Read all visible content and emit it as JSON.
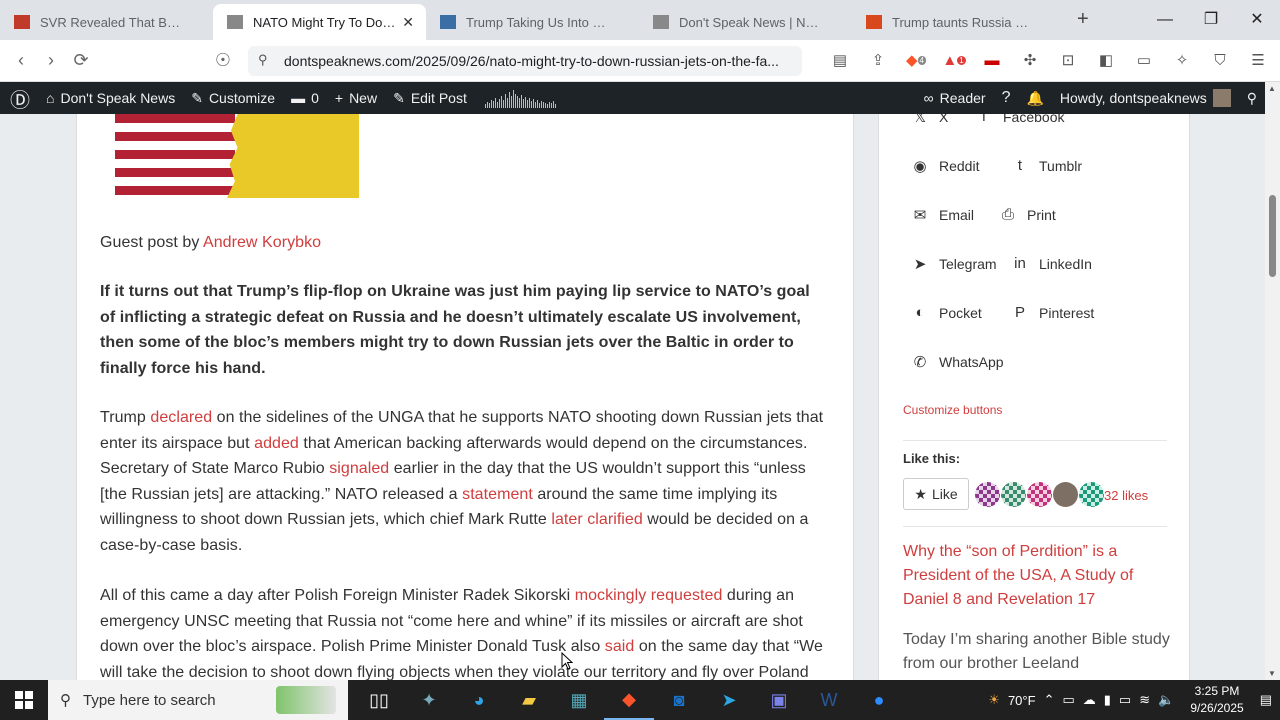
{
  "tabs": [
    {
      "title": "SVR Revealed That British & French",
      "active": false,
      "fav_color": "#c0392b"
    },
    {
      "title": "NATO Might Try To Down Russian",
      "active": true,
      "fav_color": "#888"
    },
    {
      "title": "Trump Taking Us Into World War",
      "active": false,
      "fav_color": "#3a6ea5"
    },
    {
      "title": "Don't Speak News | News You'll",
      "active": false,
      "fav_color": "#888"
    },
    {
      "title": "Trump taunts Russia as 'paper tiger'",
      "active": false,
      "fav_color": "#d9481c"
    }
  ],
  "browser": {
    "url": "dontspeaknews.com/2025/09/26/nato-might-try-to-down-russian-jets-on-the-fa...",
    "brave_badge": "4",
    "rewards_badge": "1"
  },
  "wpbar": {
    "site": "Don't Speak News",
    "customize": "Customize",
    "comments": "0",
    "new": "New",
    "edit": "Edit Post",
    "reader": "Reader",
    "howdy": "Howdy, dontspeaknews"
  },
  "article": {
    "guest_prefix": "Guest post by ",
    "author": "Andrew Korybko",
    "lead": "If it turns out that Trump’s flip-flop on Ukraine was just him paying lip service to NATO’s goal of inflicting a strategic defeat on Russia and he doesn’t ultimately escalate US involvement, then some of the bloc’s members might try to down Russian jets over the Baltic in order to finally force his hand.",
    "p1": {
      "t0": "Trump ",
      "l1": "declared",
      "t1": " on the sidelines of the UNGA that he supports NATO shooting down Russian jets that enter its airspace but ",
      "l2": "added",
      "t2": " that American backing afterwards would depend on the circumstances. Secretary of State Marco Rubio ",
      "l3": "signaled",
      "t3": " earlier in the day that the US wouldn’t support this “unless [the Russian jets] are attacking.” NATO released a ",
      "l4": "statement",
      "t4": " around the same time implying its willingness to shoot down Russian jets, which chief Mark Rutte ",
      "l5": "later clarified",
      "t5": " would be decided on a case-by-case basis."
    },
    "p2": {
      "t0": "All of this came a day after Polish Foreign Minister Radek Sikorski ",
      "l1": "mockingly requested",
      "t1": " during an emergency UNSC meeting that Russia not “come here and whine” if its missiles or aircraft are shot down over the bloc’s airspace. Polish Prime Minister Donald Tusk also ",
      "l2": "said",
      "t2": " on the same day that “We will take the decision to shoot down flying objects when they violate our territory and fly over Poland"
    }
  },
  "sidebar": {
    "share_rows": [
      [
        {
          "label": "X",
          "icon": "𝕏"
        },
        {
          "label": "Facebook",
          "icon": "f"
        }
      ],
      [
        {
          "label": "Reddit",
          "icon": "◉"
        },
        {
          "label": "Tumblr",
          "icon": "t"
        }
      ],
      [
        {
          "label": "Email",
          "icon": "✉"
        },
        {
          "label": "Print",
          "icon": "⎙"
        }
      ],
      [
        {
          "label": "Telegram",
          "icon": "➤"
        },
        {
          "label": "LinkedIn",
          "icon": "in"
        }
      ],
      [
        {
          "label": "Pocket",
          "icon": "◐"
        },
        {
          "label": "Pinterest",
          "icon": "P"
        }
      ],
      [
        {
          "label": "WhatsApp",
          "icon": "✆"
        }
      ]
    ],
    "customize_buttons": "Customize buttons",
    "like_this": "Like this:",
    "like_label": "Like",
    "likes_count": "32 likes",
    "post_title": "Why the “son of Perdition” is a President of the USA, A Study of Daniel 8 and Revelation 17",
    "post_excerpt": "Today I’m sharing another Bible study from our brother Leeland"
  },
  "taskbar": {
    "search_placeholder": "Type here to search",
    "weather": "70°F",
    "time": "3:25 PM",
    "date": "9/26/2025"
  }
}
